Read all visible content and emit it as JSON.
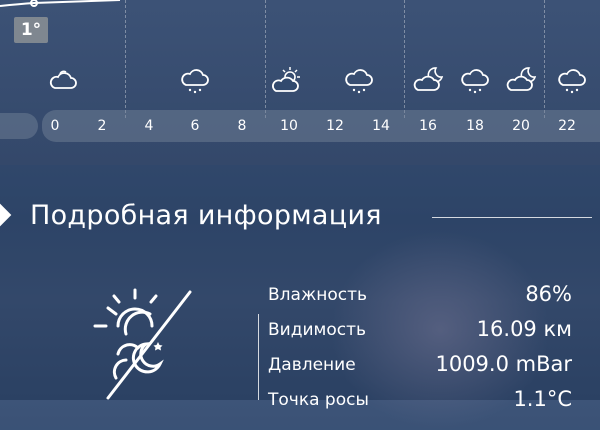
{
  "current_temp_badge": "1°",
  "hourly": {
    "hours": [
      "0",
      "2",
      "4",
      "6",
      "8",
      "10",
      "12",
      "14",
      "16",
      "18",
      "20",
      "22"
    ],
    "icons": [
      "cloud-icon",
      "rain-cloud-icon",
      "partly-sunny-icon",
      "rain-cloud-icon",
      "partly-cloudy-night-icon",
      "rain-cloud-icon",
      "partly-cloudy-night-icon",
      "rain-cloud-icon"
    ]
  },
  "details": {
    "title": "Подробная информация",
    "rows": [
      {
        "label": "Влажность",
        "value": "86%"
      },
      {
        "label": "Видимость",
        "value": "16.09 км"
      },
      {
        "label": "Давление",
        "value": "1009.0 mBar"
      },
      {
        "label": "Точка росы",
        "value": "1.1°C"
      }
    ]
  },
  "colors": {
    "badge": "#7f8790",
    "background": "#324a6e"
  }
}
